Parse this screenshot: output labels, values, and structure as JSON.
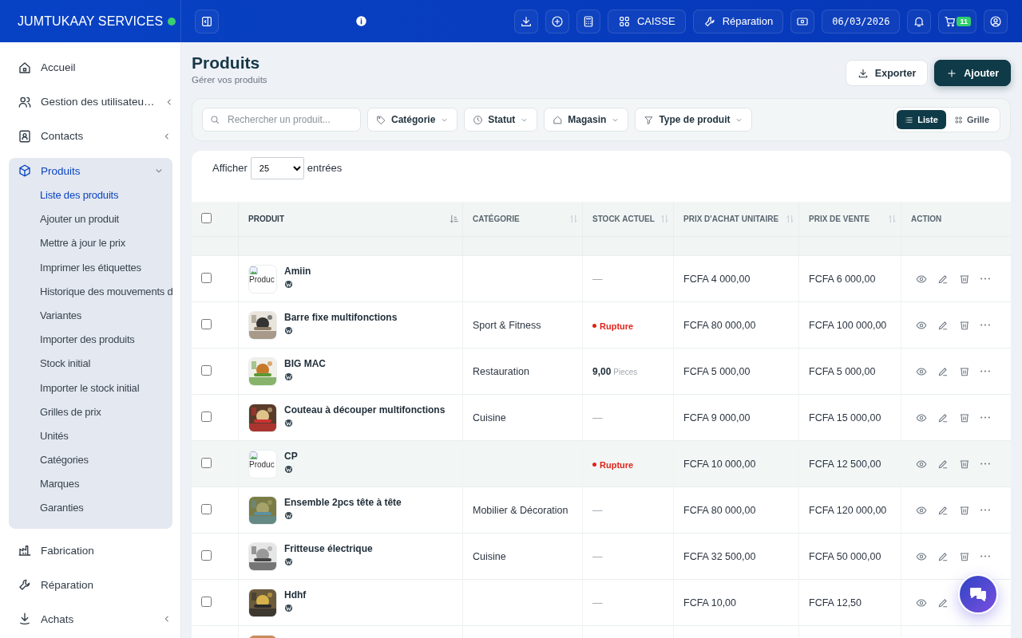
{
  "brand": {
    "name": "JUMTUKAAY SERVICES",
    "online": true
  },
  "topbar": {
    "actions": [
      {
        "kind": "icon"
      },
      {
        "kind": "icon"
      },
      {
        "kind": "icon"
      },
      {
        "kind": "label",
        "label": "CAISSE"
      },
      {
        "kind": "label",
        "label": "Réparation"
      },
      {
        "kind": "icon"
      },
      {
        "kind": "date",
        "label": "06/03/2026"
      },
      {
        "kind": "icon"
      },
      {
        "kind": "cart",
        "badge": "11"
      },
      {
        "kind": "icon"
      }
    ]
  },
  "sidebar": {
    "items": [
      {
        "label": "Accueil",
        "expandable": false,
        "selected": false
      },
      {
        "label": "Gestion des utilisateu…",
        "expandable": true,
        "expanded": false,
        "selected": false
      },
      {
        "label": "Contacts",
        "expandable": true,
        "expanded": false,
        "selected": false
      },
      {
        "label": "Produits",
        "expandable": true,
        "expanded": true,
        "selected": true,
        "children": [
          {
            "label": "Liste des produits",
            "selected": true
          },
          {
            "label": "Ajouter un produit",
            "selected": false
          },
          {
            "label": "Mettre à jour le prix",
            "selected": false
          },
          {
            "label": "Imprimer les étiquettes",
            "selected": false
          },
          {
            "label": "Historique des mouvements d",
            "selected": false
          },
          {
            "label": "Variantes",
            "selected": false
          },
          {
            "label": "Importer des produits",
            "selected": false
          },
          {
            "label": "Stock initial",
            "selected": false
          },
          {
            "label": "Importer le stock initial",
            "selected": false
          },
          {
            "label": "Grilles de prix",
            "selected": false
          },
          {
            "label": "Unités",
            "selected": false
          },
          {
            "label": "Catégories",
            "selected": false
          },
          {
            "label": "Marques",
            "selected": false
          },
          {
            "label": "Garanties",
            "selected": false
          }
        ]
      },
      {
        "label": "Fabrication",
        "expandable": false,
        "selected": false
      },
      {
        "label": "Réparation",
        "expandable": false,
        "selected": false
      },
      {
        "label": "Achats",
        "expandable": true,
        "expanded": false,
        "selected": false
      }
    ]
  },
  "page": {
    "title": "Produits",
    "subtitle": "Gérer vos produits",
    "buttons": [
      {
        "kind": "secondary",
        "label": "Exporter"
      },
      {
        "kind": "primary",
        "label": "Ajouter"
      }
    ]
  },
  "filters": {
    "search": {
      "placeholder": "Rechercher un produit..."
    },
    "dropdowns": [
      "Catégorie",
      "Statut",
      "Magasin",
      "Type de produit"
    ],
    "views": [
      {
        "label": "Liste",
        "selected": true
      },
      {
        "label": "Grille",
        "selected": false
      }
    ]
  },
  "table": {
    "show_label": "Afficher",
    "page_size": "25",
    "entries_label": "entrées",
    "select_all": {
      "checked": false
    },
    "columns": [
      {
        "label": "PRODUIT",
        "sortable": true,
        "sorted": true
      },
      {
        "label": "CATÉGORIE",
        "sortable": true,
        "sorted": false
      },
      {
        "label": "STOCK ACTUEL",
        "sortable": true,
        "sorted": false
      },
      {
        "label": "PRIX D'ACHAT UNITAIRE",
        "sortable": true,
        "sorted": false
      },
      {
        "label": "PRIX DE VENTE",
        "sortable": true,
        "sorted": false
      },
      {
        "label": "ACTION",
        "sortable": false,
        "sorted": false
      }
    ],
    "rows": [
      {
        "checked": false,
        "highlighted": false,
        "thumb": {
          "kind": "broken",
          "alt": "Produc"
        },
        "name": "Amiin",
        "category": "",
        "stock": {
          "kind": "none",
          "text": "—"
        },
        "purchase_price": "FCFA 4 000,00",
        "sale_price": "FCFA 6 000,00"
      },
      {
        "checked": false,
        "highlighted": false,
        "thumb": {
          "kind": "picture"
        },
        "name": "Barre fixe multifonctions",
        "category": "Sport & Fitness",
        "stock": {
          "kind": "out",
          "text": "Rupture"
        },
        "purchase_price": "FCFA 80 000,00",
        "sale_price": "FCFA 100 000,00"
      },
      {
        "checked": false,
        "highlighted": false,
        "thumb": {
          "kind": "picture"
        },
        "name": "BIG MAC",
        "category": "Restauration",
        "stock": {
          "kind": "qty",
          "text": "9,00",
          "unit": "Pieces"
        },
        "purchase_price": "FCFA 5 000,00",
        "sale_price": "FCFA 5 000,00"
      },
      {
        "checked": false,
        "highlighted": false,
        "thumb": {
          "kind": "picture"
        },
        "name": "Couteau à découper multifonctions",
        "category": "Cuisine",
        "stock": {
          "kind": "none",
          "text": "—"
        },
        "purchase_price": "FCFA 9 000,00",
        "sale_price": "FCFA 15 000,00"
      },
      {
        "checked": false,
        "highlighted": true,
        "thumb": {
          "kind": "broken",
          "alt": "Produc"
        },
        "name": "CP",
        "category": "",
        "stock": {
          "kind": "out",
          "text": "Rupture"
        },
        "purchase_price": "FCFA 10 000,00",
        "sale_price": "FCFA 12 500,00"
      },
      {
        "checked": false,
        "highlighted": false,
        "thumb": {
          "kind": "picture"
        },
        "name": "Ensemble 2pcs tête à tête",
        "category": "Mobilier & Décoration",
        "stock": {
          "kind": "none",
          "text": "—"
        },
        "purchase_price": "FCFA 80 000,00",
        "sale_price": "FCFA 120 000,00"
      },
      {
        "checked": false,
        "highlighted": false,
        "thumb": {
          "kind": "picture"
        },
        "name": "Fritteuse électrique",
        "category": "Cuisine",
        "stock": {
          "kind": "none",
          "text": "—"
        },
        "purchase_price": "FCFA 32 500,00",
        "sale_price": "FCFA 50 000,00"
      },
      {
        "checked": false,
        "highlighted": false,
        "thumb": {
          "kind": "picture"
        },
        "name": "Hdhf",
        "category": "",
        "stock": {
          "kind": "none",
          "text": "—"
        },
        "purchase_price": "FCFA 10,00",
        "sale_price": "FCFA 12,50"
      },
      {
        "thumb": {
          "kind": "picture"
        }
      }
    ]
  }
}
